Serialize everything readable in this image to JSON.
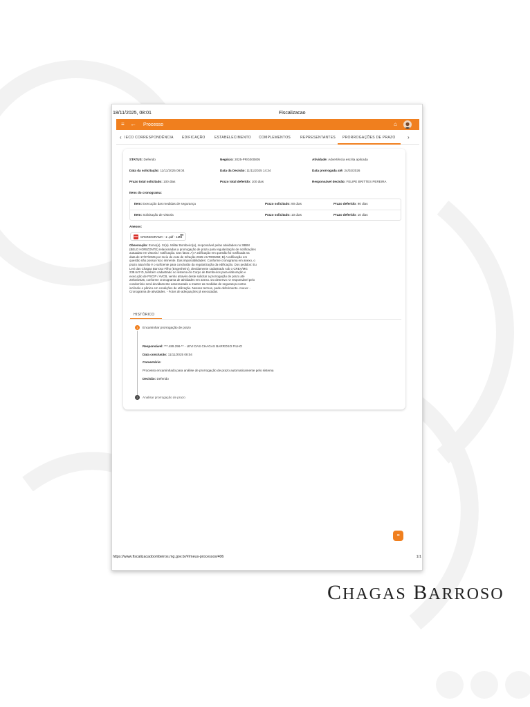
{
  "print_header": {
    "datetime": "18/11/2025, 08:01",
    "title": "Fiscalizacao"
  },
  "appbar": {
    "menu_icon": "menu-icon",
    "back_icon": "arrow-left-icon",
    "title": "Processo",
    "home_icon": "home-icon",
    "accent": "#f07f1e"
  },
  "tabs": {
    "items": [
      "IECO CORRESPONDÊNCIA",
      "EDIFICAÇÃO",
      "ESTABELECIMENTO",
      "COMPLEMENTOS",
      "REPRESENTANTES",
      "PRORROGAÇÕES DE PRAZO"
    ],
    "active": "PRORROGAÇÕES DE PRAZO"
  },
  "details": {
    "status_label": "STATUS:",
    "status": "Deferido",
    "negocio_label": "Negócio:",
    "negocio": "2025-PRG000805",
    "atividade_label": "Atividade:",
    "atividade": "Advertência escrita aplicada",
    "data_solic_label": "Data da solicitação:",
    "data_solic": "11/11/2025 08:04",
    "data_decisao_label": "Data da Decisão:",
    "data_decisao": "11/11/2025 14:34",
    "data_prorrog_label": "Data prorrogada até:",
    "data_prorrog": "24/02/2026",
    "prazo_solic_label": "Prazo total solicitado:",
    "prazo_solic": "100 dias",
    "prazo_def_label": "Prazo total deferido:",
    "prazo_def": "100 dias",
    "resp_label": "Responsável decisão:",
    "resp": "FELIPE BRITTES PEREIRA"
  },
  "itens": {
    "title": "Itens do cronograma:",
    "rows": [
      {
        "item_label": "Item:",
        "item": "Execução das medidas de segurança",
        "solic_label": "Prazo solicitado:",
        "solic": "90 dias",
        "def_label": "Prazo deferido:",
        "def": "90 dias"
      },
      {
        "item_label": "Item:",
        "item": "Solicitação de vistoria",
        "solic_label": "Prazo solicitado:",
        "solic": "10 dias",
        "def_label": "Prazo deferido:",
        "def": "10 dias"
      }
    ]
  },
  "anexos": {
    "title": "Anexos:",
    "file": "CRONOGRAMA - 1-.pdf - 1MB",
    "more": "•••"
  },
  "observacao": {
    "label": "Observação:",
    "lines": [
      "Exmo(a). Sr(a). Militar Bombeiro(a), responsável pelas atividades no 38BM",
      "(BELO HORIZONTE) relacionadas a prorrogação de prazo para regularização de notificações",
      "autuadas em vistoria / notificação. Dos fatos: A) A edificação em questão foi notificada na",
      "data de 17/07/2025 por meio do Auto de Infração 2025-AUT000259; B) A edificação em",
      "questão não possui risco iminente. Das impossibilidades: Conforme cronograma em anexo, o",
      "prazo atual não é o suficiente para conclusão da regularização da edificação. Dos pedidos: Eu",
      "Levi das Chagas Barroso Filho (Engenheiro), devidamente cadastrado sob o CREA/MG",
      "238.647-D, também cadastrado no sistema do Corpo de Bombeiros para elaboração e",
      "execução de PSCIP / AVCB, venho através deste solicitar a prorrogação de prazo até",
      "20/02/2026, conforme cronograma de atividades em anexo. Do desenvo: O responsável pelo",
      "condomínio será devidamente assessorado a manter as medidas de segurança contra",
      "incêndio e pânico em condições de utilização. Nesses termos, pede deferimento. Anexo: -",
      "Cronograma de atividades. - Fotos de adequações já executadas."
    ]
  },
  "historico": {
    "tab": "HISTÓRICO",
    "step1": {
      "num": "1",
      "title": "Encaminhar prorrogação de prazo"
    },
    "resp_label": "Responsável:",
    "resp": "***.489.296-** - LEVI DAS CHAGAS BARROSO FILHO",
    "conclusao_label": "Data conclusão:",
    "conclusao": "11/11/2025 08:04",
    "comentario_label": "Comentário:",
    "comentario": "Processo encaminhado para análise de prorrogação de prazo automaticamente pelo sistema",
    "decisao_label": "Decisão:",
    "decisao": "Deferido",
    "step2": {
      "num": "2",
      "title": "Analisar prorrogação de prazo"
    }
  },
  "fab_icon": "list-icon",
  "footer": {
    "url": "https://www.fiscalizacaobombeiros.mg.gov.br/#/meus-processos/406",
    "page": "1/1"
  },
  "brand": {
    "text": "Chagas Barroso"
  }
}
